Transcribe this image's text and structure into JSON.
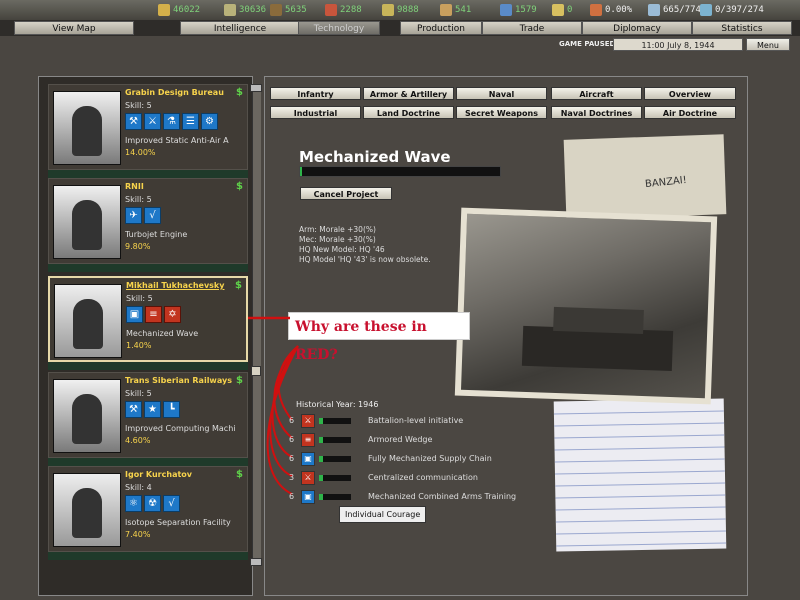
{
  "resources": [
    {
      "icon": "hammer-sickle-icon",
      "value": "46022",
      "color": "#d4b04a"
    },
    {
      "icon": "coins-icon",
      "value": "30636",
      "color": "#b9b27a"
    },
    {
      "icon": "oil-icon",
      "value": "5635",
      "color": "#8a6b3b"
    },
    {
      "icon": "metal-icon",
      "value": "2288",
      "color": "#c8553c"
    },
    {
      "icon": "rare-materials-icon",
      "value": "9888",
      "color": "#c8b55a"
    },
    {
      "icon": "supplies-icon",
      "value": "541",
      "color": "#c9a05e"
    },
    {
      "icon": "manpower-icon",
      "value": "1579",
      "color": "#5a8bc8"
    },
    {
      "icon": "nuclear-icon",
      "value": "0",
      "color": "#d8c060"
    },
    {
      "icon": "dissent-icon",
      "value": "0.00%",
      "color": "#d07040"
    },
    {
      "icon": "transport-icon",
      "value": "665/774",
      "color": "#9bbcd6"
    },
    {
      "icon": "escort-icon",
      "value": "0/397/274",
      "color": "#7cb3d0"
    }
  ],
  "nav_tabs": [
    "View Map",
    "Intelligence",
    "Technology",
    "Production",
    "Trade",
    "Diplomacy",
    "Statistics"
  ],
  "active_tab": "Technology",
  "status": {
    "paused": "GAME PAUSED",
    "datetime": "11:00 July 8, 1944",
    "menu": "Menu"
  },
  "teams": [
    {
      "name": "Grabin Design Bureau",
      "skill": "Skill: 5",
      "project": "Improved Static Anti-Air A",
      "percent": "14.00%",
      "icons": [
        {
          "g": "⚒",
          "c": "blue"
        },
        {
          "g": "⚔",
          "c": "blue"
        },
        {
          "g": "⚗",
          "c": "blue"
        },
        {
          "g": "☰",
          "c": "blue"
        },
        {
          "g": "⚙",
          "c": "blue"
        }
      ]
    },
    {
      "name": "RNII",
      "skill": "Skill: 5",
      "project": "Turbojet Engine",
      "percent": "9.80%",
      "icons": [
        {
          "g": "✈",
          "c": "blue"
        },
        {
          "g": "√",
          "c": "blue"
        }
      ]
    },
    {
      "name": "Mikhail Tukhachevsky",
      "skill": "Skill: 5",
      "project": "Mechanized Wave",
      "percent": "1.40%",
      "icons": [
        {
          "g": "▣",
          "c": "blue"
        },
        {
          "g": "≡",
          "c": "red"
        },
        {
          "g": "✡",
          "c": "red"
        }
      ]
    },
    {
      "name": "Trans Siberian Railways",
      "skill": "Skill: 5",
      "project": "Improved Computing Machi",
      "percent": "4.60%",
      "icons": [
        {
          "g": "⚒",
          "c": "blue"
        },
        {
          "g": "★",
          "c": "blue"
        },
        {
          "g": "┗",
          "c": "blue"
        }
      ]
    },
    {
      "name": "Igor Kurchatov",
      "skill": "Skill: 4",
      "project": "Isotope Separation Facility",
      "percent": "7.40%",
      "icons": [
        {
          "g": "⚛",
          "c": "blue"
        },
        {
          "g": "☢",
          "c": "blue"
        },
        {
          "g": "√",
          "c": "blue"
        }
      ]
    }
  ],
  "cat_tabs_row1": [
    "Infantry",
    "Armor & Artillery",
    "Naval",
    "Aircraft",
    "Overview"
  ],
  "cat_tabs_row2": [
    "Industrial",
    "Land Doctrine",
    "Secret Weapons",
    "Naval Doctrines",
    "Air Doctrine"
  ],
  "tech": {
    "title": "Mechanized Wave",
    "progress": 0.01,
    "cancel": "Cancel Project",
    "effects": [
      "Arm: Morale +30(%)",
      "Mec: Morale +30(%)",
      "HQ New Model: HQ '46",
      "HQ Model 'HQ '43' is now obsolete."
    ],
    "historical": "Historical Year: 1946",
    "requirements": [
      {
        "num": "6",
        "label": "Battalion-level initiative",
        "icon": "red",
        "glyph": "⚔"
      },
      {
        "num": "6",
        "label": "Armored Wedge",
        "icon": "red",
        "glyph": "≡"
      },
      {
        "num": "6",
        "label": "Fully Mechanized Supply Chain",
        "icon": "blue",
        "glyph": "▣"
      },
      {
        "num": "3",
        "label": "Centralized communication",
        "icon": "red",
        "glyph": "⚔"
      },
      {
        "num": "6",
        "label": "Mechanized Combined Arms Training",
        "icon": "blue",
        "glyph": "▣"
      }
    ],
    "tooltip": "Individual Courage"
  },
  "annotation": "Why are these in RED?",
  "photo_note": "BANZAI!"
}
